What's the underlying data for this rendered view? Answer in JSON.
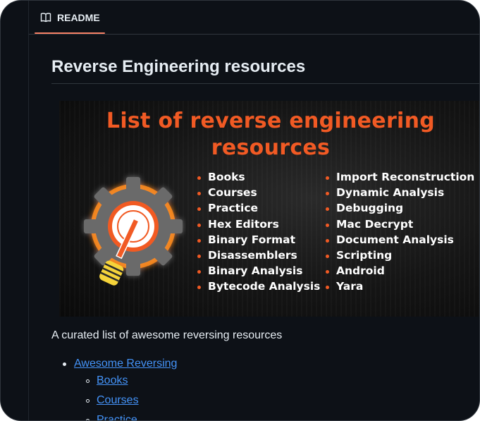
{
  "tabs": {
    "readme_label": "README"
  },
  "readme": {
    "title": "Reverse Engineering resources",
    "description": "A curated list of awesome reversing resources"
  },
  "banner": {
    "title_line1": "List of  reverse engineering",
    "title_line2": "resources",
    "left_items": [
      "Books",
      "Courses",
      "Practice",
      "Hex Editors",
      "Binary Format",
      "Disassemblers",
      "Binary Analysis",
      "Bytecode Analysis"
    ],
    "right_items": [
      "Import Reconstruction",
      "Dynamic Analysis",
      "Debugging",
      "Mac Decrypt",
      "Document Analysis",
      "Scripting",
      "Android",
      "Yara"
    ]
  },
  "toc": {
    "top": "Awesome Reversing",
    "children": [
      "Books",
      "Courses",
      "Practice"
    ]
  },
  "colors": {
    "accent_orange": "#f15a24",
    "link_blue": "#4493f8",
    "tab_underline": "#f78166",
    "background": "#0d1117"
  }
}
